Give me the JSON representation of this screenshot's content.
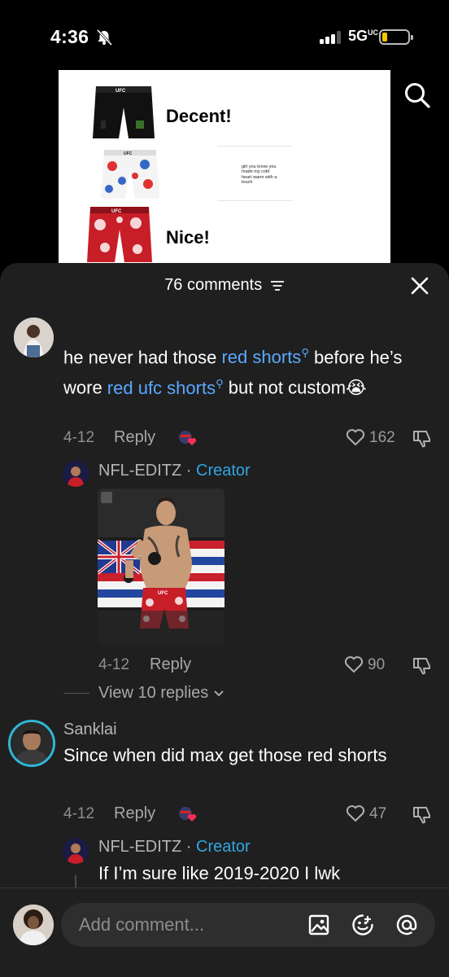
{
  "status_bar": {
    "time": "4:36",
    "network": "5G",
    "network_suffix": "UC"
  },
  "video": {
    "ratings": [
      "Decent!",
      "Nice!"
    ],
    "note_text": "girl you know you made my cold heart warm with a touch"
  },
  "comments_panel": {
    "count_label": "76 comments",
    "comments": [
      {
        "text_parts": [
          "he never had those ",
          "red shorts",
          " before he’s wore ",
          "red ufc shorts",
          " but not custom"
        ],
        "emoji": "😭",
        "date": "4-12",
        "reply_label": "Reply",
        "likes": "162",
        "reply": {
          "username": "NFL-EDITZ",
          "separator": "·",
          "badge": "Creator",
          "date": "4-12",
          "reply_label": "Reply",
          "likes": "90",
          "view_replies": "View 10 replies"
        }
      },
      {
        "username": "Sanklai",
        "text": "Since when did max get those red shorts",
        "date": "4-12",
        "reply_label": "Reply",
        "likes": "47",
        "reply": {
          "username": "NFL-EDITZ",
          "separator": "·",
          "badge": "Creator",
          "text": "If I’m sure like 2019-2020 I lwk"
        }
      }
    ]
  },
  "composer": {
    "placeholder": "Add comment..."
  },
  "colors": {
    "sheet_bg": "#1f1f1f",
    "link_blue": "#5aa8ff",
    "creator_blue": "#2fa6e0",
    "battery": "#f5c400",
    "heart_red": "#ff2d55"
  }
}
